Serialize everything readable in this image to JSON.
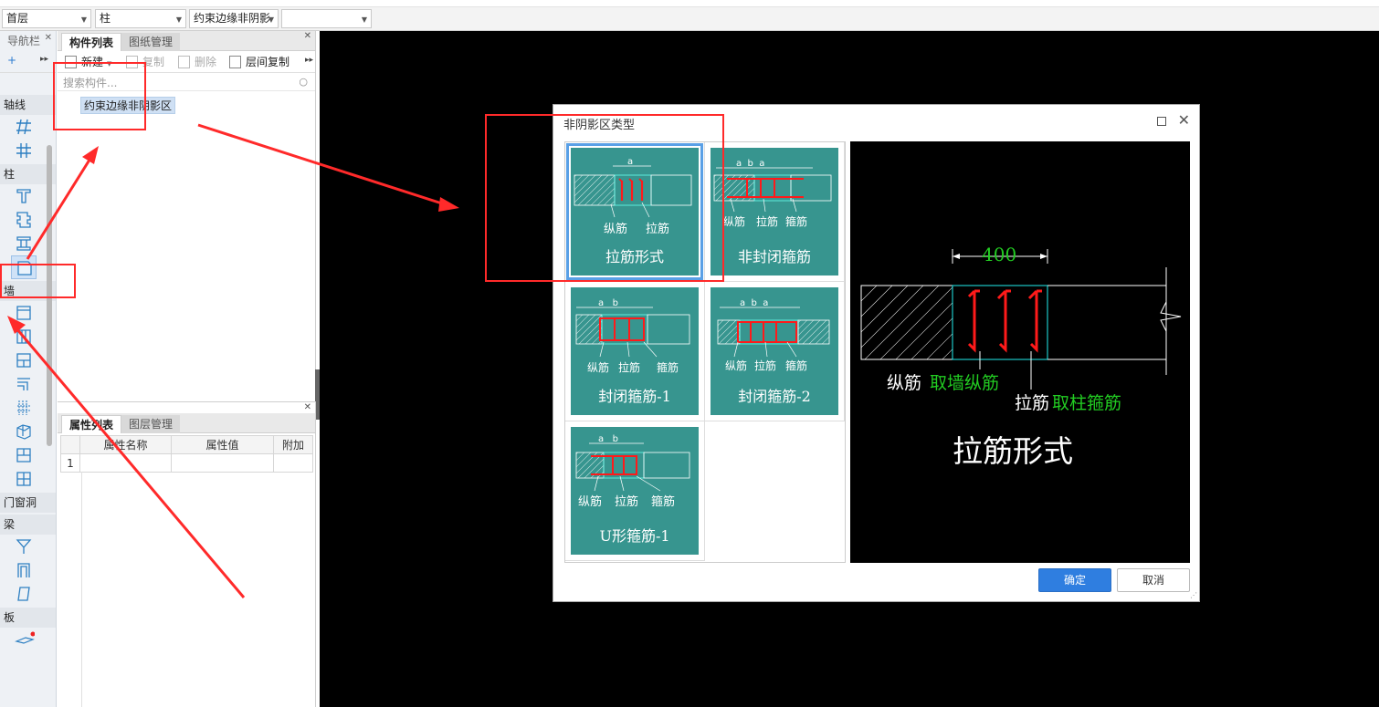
{
  "toolbar": {
    "floor_select": "首层",
    "type_select": "柱",
    "subtype_select": "约束边缘非阴影",
    "extra_select": ""
  },
  "nav": {
    "title": "导航栏",
    "sections": [
      "轴线",
      "柱",
      "墙",
      "门窗洞",
      "梁",
      "板"
    ]
  },
  "component_panel": {
    "tabs": [
      "构件列表",
      "图纸管理"
    ],
    "tools": {
      "new": "新建",
      "copy": "复制",
      "delete": "删除",
      "floor_copy": "层间复制"
    },
    "search_placeholder": "搜索构件...",
    "items": [
      "约束边缘非阴影区"
    ]
  },
  "property_panel": {
    "tabs": [
      "属性列表",
      "图层管理"
    ],
    "columns": [
      "属性名称",
      "属性值",
      "附加"
    ],
    "row_number": "1"
  },
  "dialog": {
    "title": "非阴影区类型",
    "options": [
      {
        "label": "拉筋形式",
        "dim": "a",
        "rebar_labels": [
          "纵筋",
          "拉筋"
        ],
        "selected": true
      },
      {
        "label": "非封闭箍筋",
        "dim": "a  b  a",
        "rebar_labels": [
          "纵筋",
          "拉筋",
          "箍筋"
        ],
        "selected": false
      },
      {
        "label": "封闭箍筋-1",
        "dim": "a   b",
        "rebar_labels": [
          "纵筋",
          "拉筋",
          "箍筋"
        ],
        "selected": false
      },
      {
        "label": "封闭箍筋-2",
        "dim": "a  b  a",
        "rebar_labels": [
          "纵筋",
          "拉筋",
          "箍筋"
        ],
        "selected": false
      },
      {
        "label": "U形箍筋-1",
        "dim": "a   b",
        "rebar_labels": [
          "纵筋",
          "拉筋",
          "箍筋"
        ],
        "selected": false
      }
    ],
    "preview": {
      "dimension": "400",
      "label_longitudinal": "纵筋",
      "note_longitudinal": "取墙纵筋",
      "label_tie": "拉筋",
      "note_tie": "取柱箍筋",
      "title": "拉筋形式"
    },
    "ok_label": "确定",
    "cancel_label": "取消"
  },
  "colors": {
    "card_bg": "#37958f",
    "rebar": "#ff1a1a",
    "accent_green": "#22cc22",
    "annotation_red": "#ff2a2a",
    "ok_button": "#2f7ee0"
  }
}
